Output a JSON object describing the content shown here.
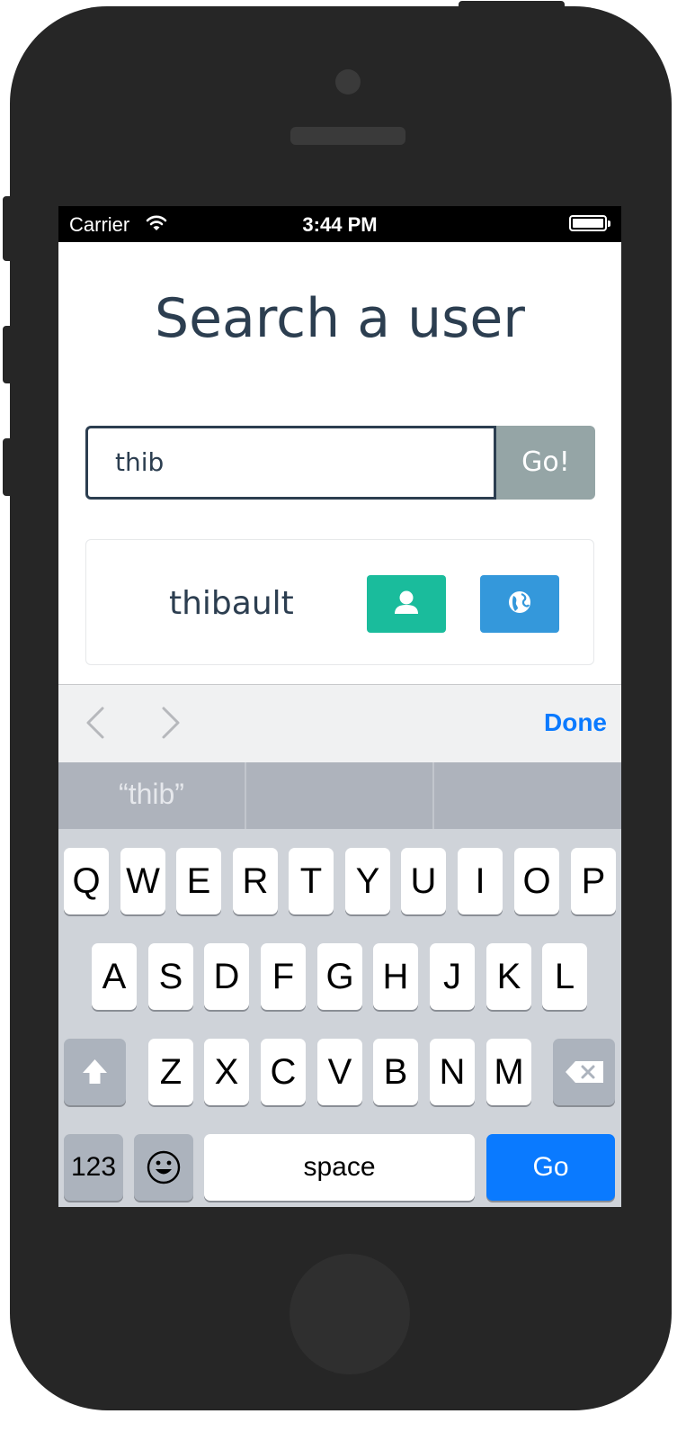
{
  "status_bar": {
    "carrier": "Carrier",
    "time": "3:44 PM"
  },
  "page": {
    "title": "Search a user"
  },
  "search": {
    "value": "thib",
    "button_label": "Go!"
  },
  "results": [
    {
      "username": "thibault"
    }
  ],
  "accessory_bar": {
    "done_label": "Done"
  },
  "suggestions": [
    "“thib”",
    "",
    ""
  ],
  "keyboard": {
    "row1": [
      "Q",
      "W",
      "E",
      "R",
      "T",
      "Y",
      "U",
      "I",
      "O",
      "P"
    ],
    "row2": [
      "A",
      "S",
      "D",
      "F",
      "G",
      "H",
      "J",
      "K",
      "L"
    ],
    "row3": [
      "Z",
      "X",
      "C",
      "V",
      "B",
      "N",
      "M"
    ],
    "numbers_label": "123",
    "space_label": "space",
    "return_label": "Go"
  },
  "colors": {
    "primary_text": "#2c3e50",
    "go_button": "#95a5a6",
    "profile_button": "#1abc9c",
    "web_button": "#3498db",
    "keyboard_accent": "#0a7aff"
  }
}
